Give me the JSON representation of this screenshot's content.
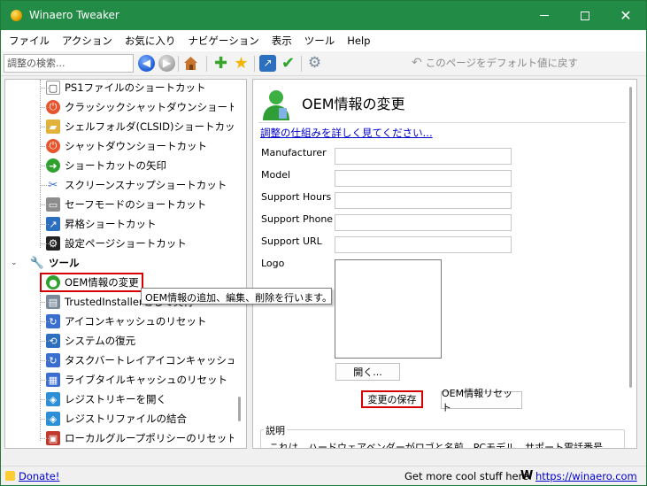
{
  "window": {
    "title": "Winaero Tweaker"
  },
  "menu": [
    "ファイル",
    "アクション",
    "お気に入り",
    "ナビゲーション",
    "表示",
    "ツール",
    "Help"
  ],
  "toolbar": {
    "search_placeholder": "調整の検索...",
    "reset_default": "このページをデフォルト値に戻す"
  },
  "tree": {
    "items": [
      {
        "label": "PS1ファイルのショートカット",
        "icon": "ps1-icon",
        "color": "#ffffff"
      },
      {
        "label": "クラッシックシャットダウンショートカット",
        "icon": "power-icon",
        "color": "#e8542c"
      },
      {
        "label": "シェルフォルダ(CLSID)ショートカット",
        "icon": "folder-icon",
        "color": "#e2b33a"
      },
      {
        "label": "シャットダウンショートカット",
        "icon": "power-icon",
        "color": "#e8542c"
      },
      {
        "label": "ショートカットの矢印",
        "icon": "green-arrow-icon",
        "color": "#2fa12f"
      },
      {
        "label": "スクリーンスナップショートカット",
        "icon": "scissors-icon",
        "color": "#3a6fd0"
      },
      {
        "label": "セーフモードのショートカット",
        "icon": "window-icon",
        "color": "#8c8c8c"
      },
      {
        "label": "昇格ショートカット",
        "icon": "elevated-icon",
        "color": "#2d6fbf"
      },
      {
        "label": "設定ページショートカット",
        "icon": "gear-icon",
        "color": "#222222"
      }
    ],
    "category": {
      "label": "ツール",
      "icon": "tools-icon"
    },
    "tool_items": [
      {
        "label": "OEM情報の変更",
        "icon": "user-icon",
        "color": "#2fa12f"
      },
      {
        "label": "TrustedInstallerとして実行",
        "icon": "console-icon",
        "color": "#7a8a9a"
      },
      {
        "label": "アイコンキャッシュのリセット",
        "icon": "refresh-icon",
        "color": "#3a6fd0"
      },
      {
        "label": "システムの復元",
        "icon": "restore-icon",
        "color": "#2d6fbf"
      },
      {
        "label": "タスクバートレイアイコンキャッシュをリセット",
        "icon": "refresh-icon",
        "color": "#3a6fd0"
      },
      {
        "label": "ライブタイルキャッシュのリセット",
        "icon": "tiles-icon",
        "color": "#3a6fd0"
      },
      {
        "label": "レジストリキーを開く",
        "icon": "registry-icon",
        "color": "#2d8fd8"
      },
      {
        "label": "レジストリファイルの結合",
        "icon": "registry-icon",
        "color": "#2d8fd8"
      },
      {
        "label": "ローカルグループポリシーのリセット",
        "icon": "policy-icon",
        "color": "#c0392b"
      }
    ],
    "tooltip": "OEM情報の追加、編集、削除を行います。"
  },
  "panel": {
    "title": "OEM情報の変更",
    "link": "調整の仕組みを詳しく見てください...",
    "fields": [
      {
        "label": "Manufacturer",
        "value": ""
      },
      {
        "label": "Model",
        "value": ""
      },
      {
        "label": "Support Hours",
        "value": ""
      },
      {
        "label": "Support Phone",
        "value": ""
      },
      {
        "label": "Support URL",
        "value": ""
      }
    ],
    "logo_label": "Logo",
    "open_button": "開く...",
    "save_button": "変更の保存",
    "reset_button": "OEM情報リセット",
    "description_title": "説明",
    "description_text": "これは、ハードウェアベンダーがロゴと名前、PCモデル、サポート電話番号、サポートURL、および営業時間を表示するために追加できる特別な情報です。この情報"
  },
  "status": {
    "donate": "Donate!",
    "cool_stuff": "Get more cool stuff here:",
    "site": "https://winaero.com"
  }
}
